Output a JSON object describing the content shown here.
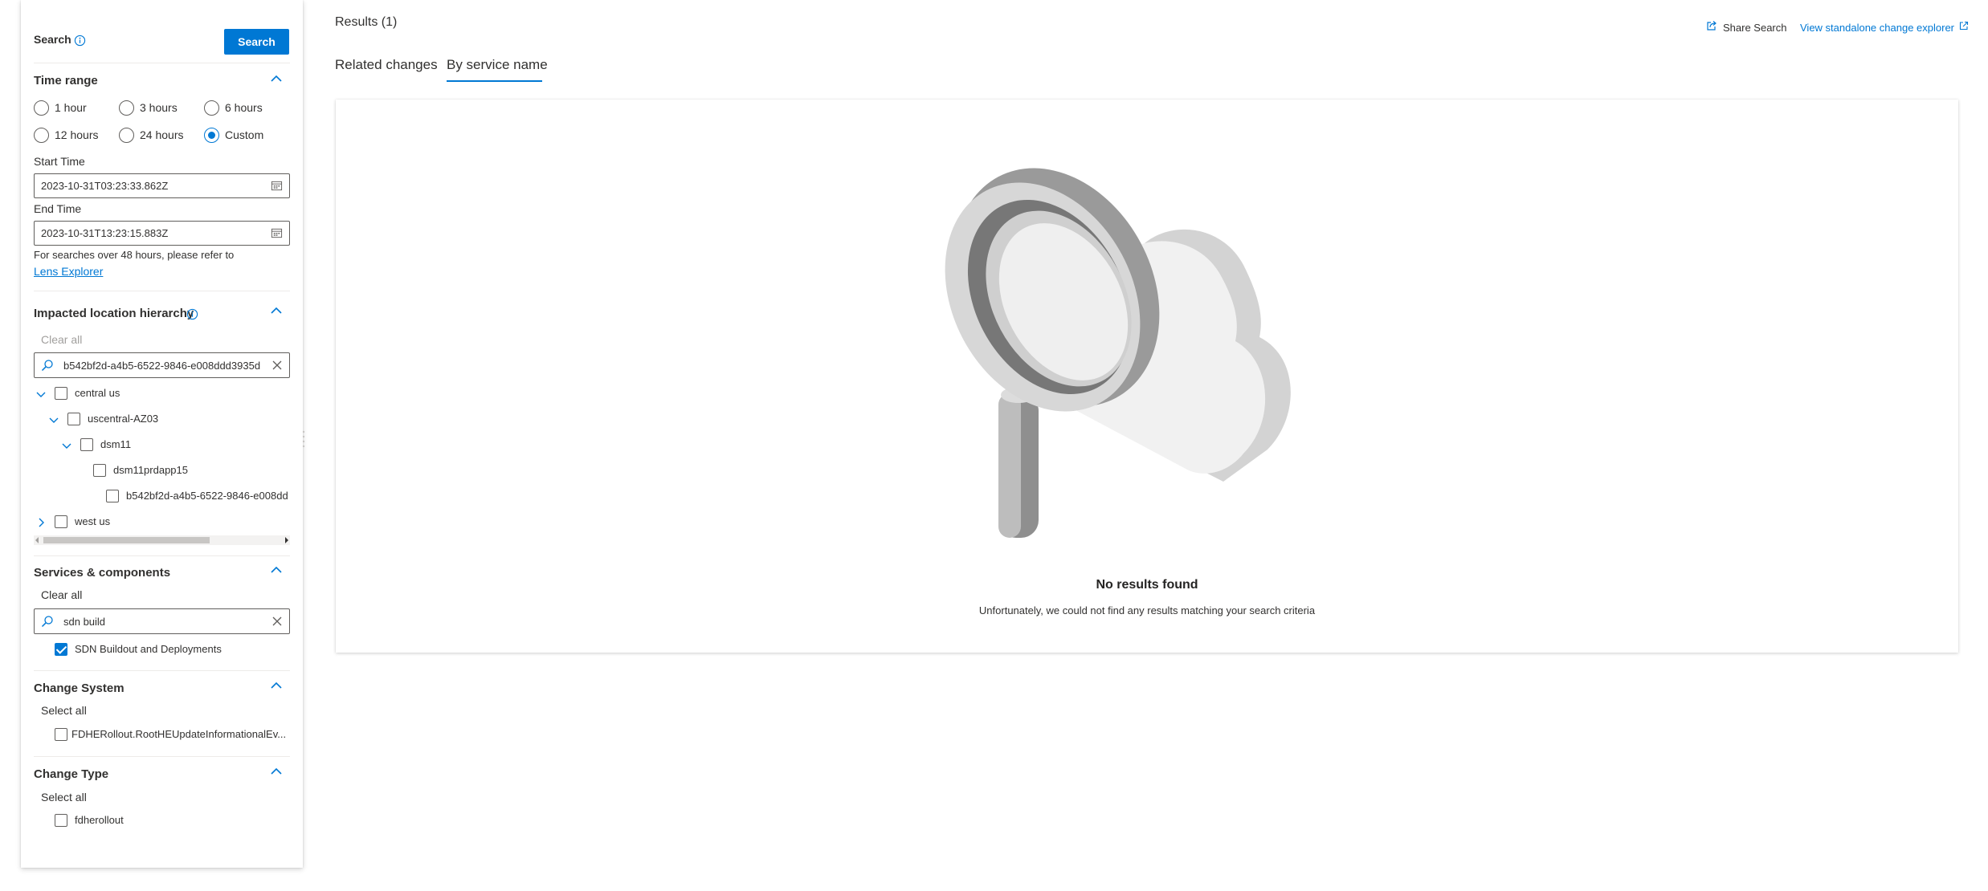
{
  "search": {
    "label": "Search",
    "button_label": "Search"
  },
  "time_range": {
    "title": "Time range",
    "options": [
      "1 hour",
      "3 hours",
      "6 hours",
      "12 hours",
      "24 hours",
      "Custom"
    ],
    "selected": "Custom",
    "start_label": "Start Time",
    "start_value": "2023-10-31T03:23:33.862Z",
    "end_label": "End Time",
    "end_value": "2023-10-31T13:23:15.883Z",
    "note": "For searches over 48 hours, please refer to",
    "note_link": "Lens Explorer"
  },
  "location": {
    "title": "Impacted location hierarchy",
    "clear_all": "Clear all",
    "search_value": "b542bf2d-a4b5-6522-9846-e008ddd3935d",
    "tree": [
      {
        "label": "central us",
        "expanded": true
      },
      {
        "label": "uscentral-AZ03",
        "expanded": true
      },
      {
        "label": "dsm11",
        "expanded": true
      },
      {
        "label": "dsm11prdapp15"
      },
      {
        "label": "b542bf2d-a4b5-6522-9846-e008dd"
      },
      {
        "label": "west us",
        "expanded": false
      }
    ]
  },
  "services": {
    "title": "Services & components",
    "clear_all": "Clear all",
    "search_value": "sdn build",
    "items": [
      {
        "label": "SDN Buildout and Deployments",
        "checked": true
      }
    ]
  },
  "change_system": {
    "title": "Change System",
    "select_all": "Select all",
    "items": [
      {
        "label": "FDHERollout.RootHEUpdateInformationalEv...",
        "checked": false
      }
    ]
  },
  "change_type": {
    "title": "Change Type",
    "select_all": "Select all",
    "items": [
      {
        "label": "fdherollout",
        "checked": false
      }
    ]
  },
  "header": {
    "results_label": "Results (1)",
    "share_label": "Share Search",
    "standalone_label": "View standalone change explorer"
  },
  "tabs": [
    {
      "label": "Related changes",
      "active": false
    },
    {
      "label": "By service name",
      "active": true
    }
  ],
  "empty_state": {
    "title": "No results found",
    "message": "Unfortunately, we could not find any results matching your search criteria"
  },
  "colors": {
    "accent": "#0078d4",
    "text": "#323130",
    "muted": "#a19f9d",
    "border": "#605e5c"
  },
  "icons": [
    "info-icon",
    "calendar-icon",
    "chevron-up-icon",
    "search-icon",
    "close-icon",
    "chevron-down-icon",
    "chevron-right-icon",
    "share-icon",
    "external-link-icon",
    "magnifier-cloud-illustration"
  ]
}
